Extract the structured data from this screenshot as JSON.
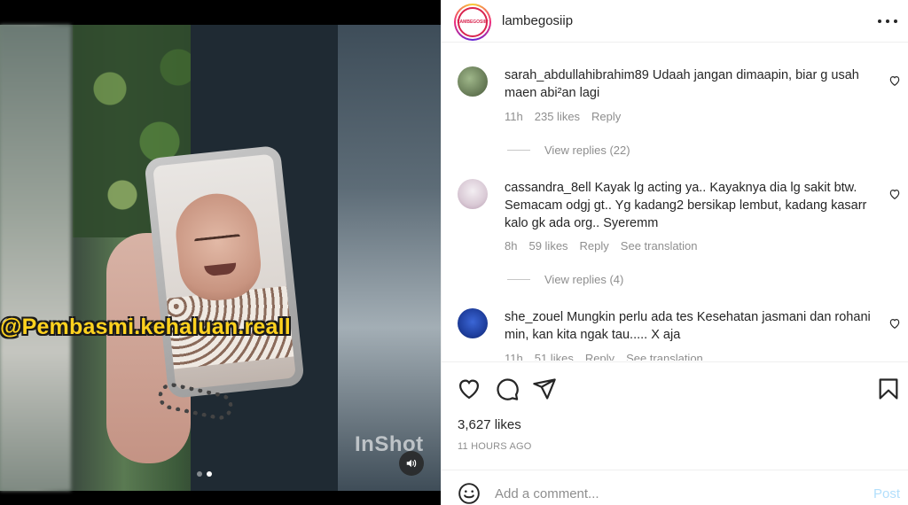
{
  "media": {
    "watermark_text": "@Pembasmi.kehaluan.reall",
    "inshot_logo": "InShot",
    "carousel_dots": 2,
    "carousel_active_index": 1,
    "sound_icon": "volume-icon"
  },
  "post_header": {
    "username": "lambegosiip",
    "avatar_text": "LAMBEGOSIIP",
    "more_icon": "more-horizontal-icon"
  },
  "comments": [
    {
      "username": "sarah_abdullahibrahim89",
      "text": "Udaah jangan dimaapin, biar g usah maen abi²an lagi",
      "time": "11h",
      "likes": "235 likes",
      "reply_label": "Reply",
      "view_replies": "View replies (22)",
      "avatar_color": "#7a8f6a"
    },
    {
      "username": "cassandra_8ell",
      "text": "Kayak lg acting ya.. Kayaknya dia lg sakit btw. Semacam odgj gt.. Yg kadang2 bersikap lembut, kadang kasarr kalo gk ada org.. Syeremm",
      "time": "8h",
      "likes": "59 likes",
      "reply_label": "Reply",
      "translation_label": "See translation",
      "view_replies": "View replies (4)",
      "avatar_color": "#e8dfe6"
    },
    {
      "username": "she_zouel",
      "text": "Mungkin perlu ada tes Kesehatan jasmani dan rohani min, kan kita ngak tau..... X aja",
      "time": "11h",
      "likes": "51 likes",
      "reply_label": "Reply",
      "translation_label": "See translation",
      "avatar_color": "#1f3f9e"
    }
  ],
  "actions": {
    "like_icon": "heart-icon",
    "comment_icon": "comment-icon",
    "share_icon": "share-icon",
    "save_icon": "bookmark-icon",
    "likes_count": "3,627 likes",
    "time_ago": "11 HOURS AGO"
  },
  "add_comment": {
    "emoji_icon": "emoji-icon",
    "placeholder": "Add a comment...",
    "post_label": "Post"
  }
}
